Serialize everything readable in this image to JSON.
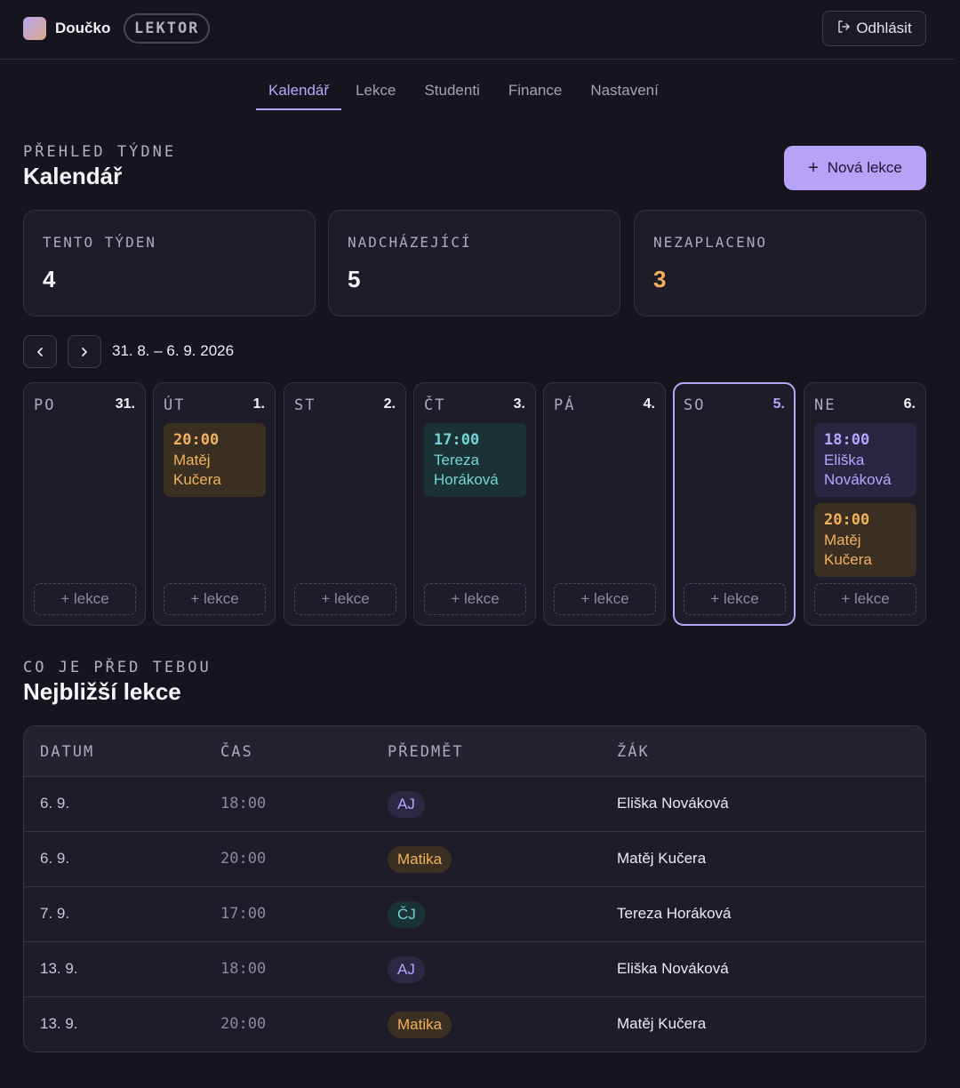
{
  "app": {
    "name": "Doučko",
    "role": "LEKTOR",
    "logout": "Odhlásit"
  },
  "tabs": [
    {
      "label": "Kalendář",
      "active": true
    },
    {
      "label": "Lekce",
      "active": false
    },
    {
      "label": "Studenti",
      "active": false
    },
    {
      "label": "Finance",
      "active": false
    },
    {
      "label": "Nastavení",
      "active": false
    }
  ],
  "overview": {
    "eyebrow": "PŘEHLED TÝDNE",
    "title": "Kalendář",
    "new_lesson": "Nová lekce"
  },
  "stats": [
    {
      "label": "TENTO TÝDEN",
      "value": "4"
    },
    {
      "label": "NADCHÁZEJÍCÍ",
      "value": "5"
    },
    {
      "label": "NEZAPLACENO",
      "value": "3"
    }
  ],
  "week": {
    "range": "31. 8. – 6. 9. 2026",
    "add_label": "+ lekce",
    "days": [
      {
        "name": "PO",
        "num": "31.",
        "events": []
      },
      {
        "name": "ÚT",
        "num": "1.",
        "events": [
          {
            "time": "20:00",
            "line1": "Matěj",
            "line2": "Kučera",
            "color": "#f2b25e"
          }
        ]
      },
      {
        "name": "ST",
        "num": "2.",
        "events": []
      },
      {
        "name": "ČT",
        "num": "3.",
        "events": [
          {
            "time": "17:00",
            "line1": "Tereza",
            "line2": "Horáková",
            "color": "#74d3d9"
          }
        ]
      },
      {
        "name": "PÁ",
        "num": "4.",
        "events": []
      },
      {
        "name": "SO",
        "num": "5.",
        "today": true,
        "events": []
      },
      {
        "name": "NE",
        "num": "6.",
        "events": [
          {
            "time": "18:00",
            "line1": "Eliška",
            "line2": "Nováková",
            "color": "#b7a6ff"
          },
          {
            "time": "20:00",
            "line1": "Matěj",
            "line2": "Kučera",
            "color": "#f2b25e"
          }
        ]
      }
    ]
  },
  "upcoming": {
    "eyebrow": "CO JE PŘED TEBOU",
    "title": "Nejbližší lekce",
    "columns": [
      "DATUM",
      "ČAS",
      "PŘEDMĚT",
      "ŽÁK"
    ],
    "rows": [
      {
        "date": "6. 9.",
        "time": "18:00",
        "subject": "AJ",
        "student": "Eliška Nováková"
      },
      {
        "date": "6. 9.",
        "time": "20:00",
        "subject": "Matika",
        "student": "Matěj Kučera"
      },
      {
        "date": "7. 9.",
        "time": "17:00",
        "subject": "ČJ",
        "student": "Tereza Horáková"
      },
      {
        "date": "13. 9.",
        "time": "18:00",
        "subject": "AJ",
        "student": "Eliška Nováková"
      },
      {
        "date": "13. 9.",
        "time": "20:00",
        "subject": "Matika",
        "student": "Matěj Kučera"
      }
    ]
  },
  "colors": {
    "accent": "#b5a3f7",
    "warn": "#f3b05c",
    "teal": "#74d3d9",
    "background": "#16141d"
  }
}
